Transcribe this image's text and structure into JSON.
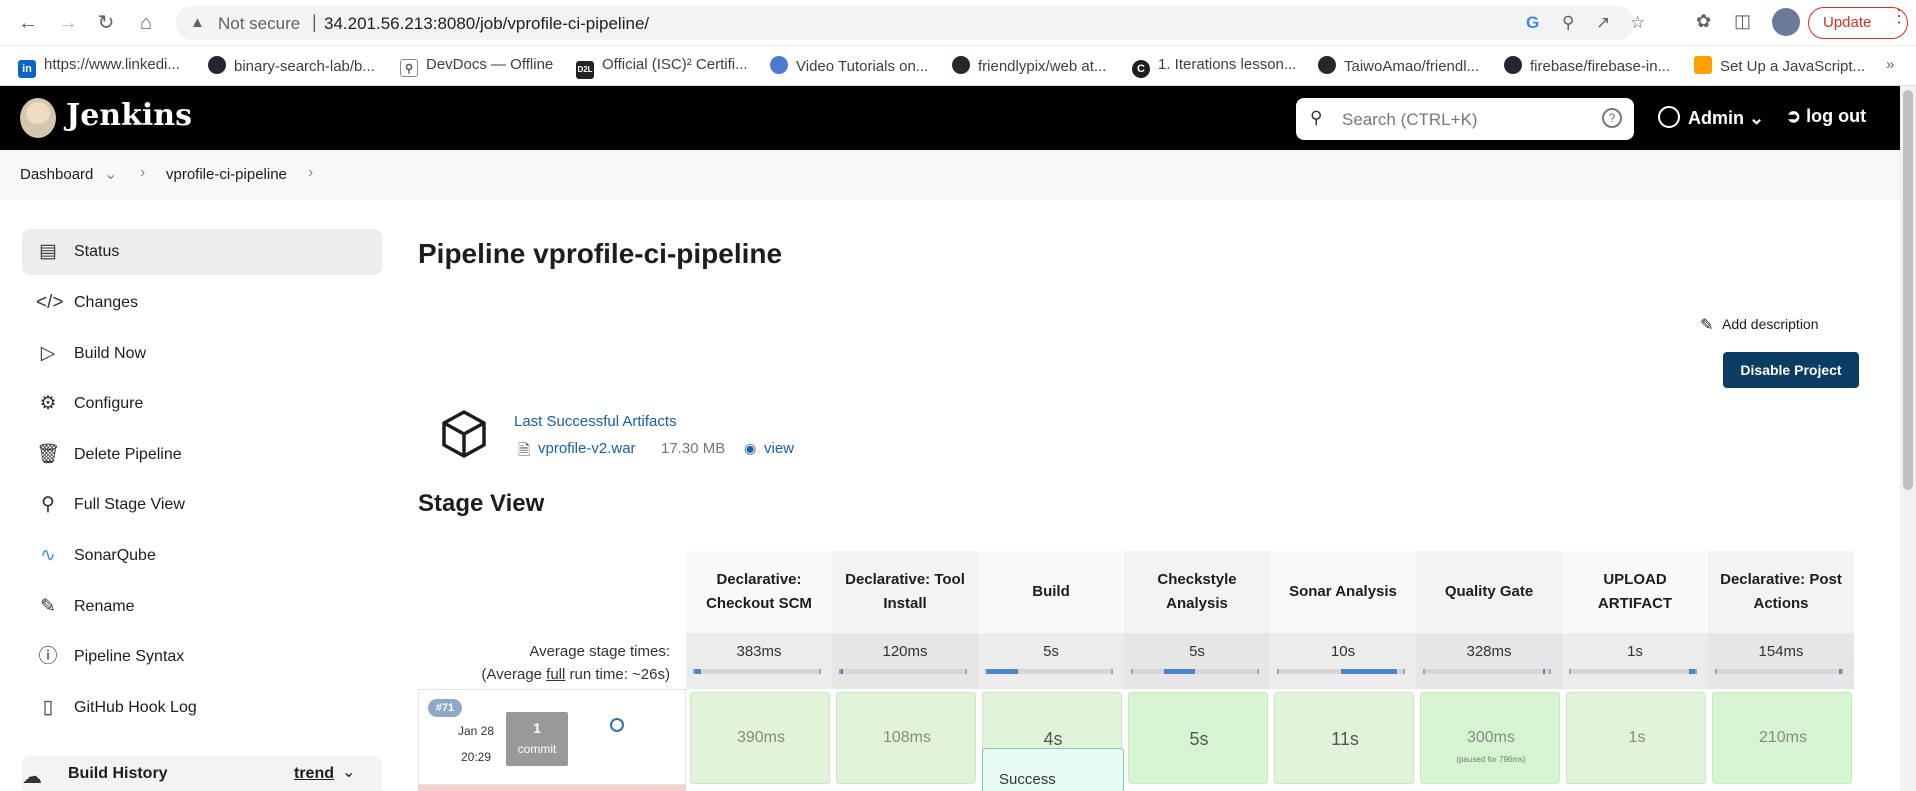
{
  "browser": {
    "not_secure": "Not secure",
    "url": "34.201.56.213:8080/job/vprofile-ci-pipeline/",
    "update_label": "Update",
    "bookmarks": [
      {
        "label": "https://www.linkedi...",
        "icon": "linkedin-icon",
        "color": "#0a66c2"
      },
      {
        "label": "binary-search-lab/b...",
        "icon": "github-icon",
        "color": "#24292f"
      },
      {
        "label": "DevDocs — Offline",
        "icon": "devdocs-icon",
        "color": "#888888"
      },
      {
        "label": "Official (ISC)² Certifi...",
        "icon": "d2l-icon",
        "color": "#222222"
      },
      {
        "label": "Video Tutorials on...",
        "icon": "video-icon",
        "color": "#4a7bd0"
      },
      {
        "label": "friendlypix/web at...",
        "icon": "github-icon",
        "color": "#24292f"
      },
      {
        "label": "1. Iterations lesson...",
        "icon": "codecademy-icon",
        "color": "#1f1f1f"
      },
      {
        "label": "TaiwoAmao/friendl...",
        "icon": "github-icon",
        "color": "#24292f"
      },
      {
        "label": "firebase/firebase-in...",
        "icon": "github-icon",
        "color": "#24292f"
      },
      {
        "label": "Set Up a JavaScript...",
        "icon": "firebase-icon",
        "color": "#ffa000"
      }
    ]
  },
  "header": {
    "app_name": "Jenkins",
    "search_placeholder": "Search (CTRL+K)",
    "user": "Admin",
    "logout": "log out"
  },
  "breadcrumb": {
    "dashboard": "Dashboard",
    "job": "vprofile-ci-pipeline"
  },
  "sidebar": {
    "items": [
      {
        "label": "Status",
        "icon": "document-icon"
      },
      {
        "label": "Changes",
        "icon": "code-icon"
      },
      {
        "label": "Build Now",
        "icon": "play-icon"
      },
      {
        "label": "Configure",
        "icon": "gear-icon"
      },
      {
        "label": "Delete Pipeline",
        "icon": "trash-icon"
      },
      {
        "label": "Full Stage View",
        "icon": "magnifier-icon"
      },
      {
        "label": "SonarQube",
        "icon": "sonarqube-icon"
      },
      {
        "label": "Rename",
        "icon": "pencil-icon"
      },
      {
        "label": "Pipeline Syntax",
        "icon": "help-icon"
      },
      {
        "label": "GitHub Hook Log",
        "icon": "clipboard-icon"
      }
    ],
    "build_history": "Build History",
    "trend": "trend"
  },
  "main": {
    "title": "Pipeline vprofile-ci-pipeline",
    "add_description": "Add description",
    "disable_project": "Disable Project",
    "last_artifacts": "Last Successful Artifacts",
    "artifact_file": "vprofile-v2.war",
    "artifact_size": "17.30 MB",
    "artifact_view": "view",
    "stage_view": "Stage View"
  },
  "stage_view": {
    "avg_label": "Average stage times:",
    "avg_full_prefix": "(Average ",
    "avg_full_word": "full",
    "avg_full_suffix": " run time: ~26s)",
    "stages": [
      {
        "name": "Declarative: Checkout SCM",
        "avg": "383ms",
        "bar_start": 0.0,
        "bar_len": 0.05
      },
      {
        "name": "Declarative: Tool Install",
        "avg": "120ms",
        "bar_start": 0.0,
        "bar_len": 0.02
      },
      {
        "name": "Build",
        "avg": "5s",
        "bar_start": 0.0,
        "bar_len": 0.25
      },
      {
        "name": "Checkstyle Analysis",
        "avg": "5s",
        "bar_start": 0.25,
        "bar_len": 0.25
      },
      {
        "name": "Sonar Analysis",
        "avg": "10s",
        "bar_start": 0.5,
        "bar_len": 0.45
      },
      {
        "name": "Quality Gate",
        "avg": "328ms",
        "bar_start": 0.95,
        "bar_len": 0.02
      },
      {
        "name": "UPLOAD ARTIFACT",
        "avg": "1s",
        "bar_start": 0.95,
        "bar_len": 0.05
      },
      {
        "name": "Declarative: Post Actions",
        "avg": "154ms",
        "bar_start": 0.98,
        "bar_len": 0.02
      }
    ],
    "run": {
      "number": "#71",
      "date": "Jan 28",
      "time": "20:29",
      "commit_count": "1",
      "commit_label": "commit",
      "cells": [
        {
          "value": "390ms",
          "sub": ""
        },
        {
          "value": "108ms",
          "sub": ""
        },
        {
          "value": "4s",
          "sub": ""
        },
        {
          "value": "5s",
          "sub": ""
        },
        {
          "value": "11s",
          "sub": ""
        },
        {
          "value": "300ms",
          "sub": "(paused for 796ms)"
        },
        {
          "value": "1s",
          "sub": ""
        },
        {
          "value": "210ms",
          "sub": ""
        }
      ]
    },
    "popup": "Success"
  }
}
